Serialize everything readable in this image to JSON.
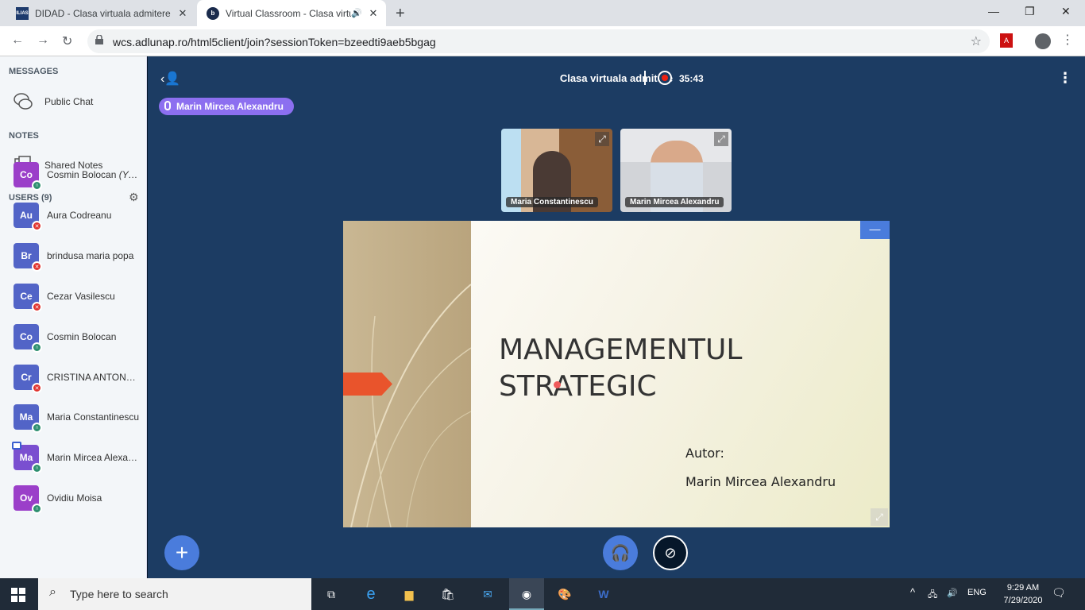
{
  "browser": {
    "tabs": [
      {
        "favicon": "ILIAS",
        "title": "DIDAD - Clasa virtuala admitere"
      },
      {
        "favicon": "b",
        "title": "Virtual Classroom - Clasa virtu"
      }
    ],
    "url": "wcs.adlunap.ro/html5client/join?sessionToken=bzeedti9aeb5bgag"
  },
  "sidebar": {
    "messages_header": "MESSAGES",
    "public_chat": "Public Chat",
    "notes_header": "NOTES",
    "shared_notes": "Shared Notes",
    "users_header": "USERS (9)",
    "users": [
      {
        "initials": "Co",
        "name": "Cosmin Bolocan",
        "suffix": "(You)",
        "color": "#9b3fc9",
        "status": "listen"
      },
      {
        "initials": "Au",
        "name": "Aura Codreanu",
        "color": "#5264c7",
        "status": "muted"
      },
      {
        "initials": "Br",
        "name": "brindusa maria popa",
        "color": "#5264c7",
        "status": "muted"
      },
      {
        "initials": "Ce",
        "name": "Cezar Vasilescu",
        "color": "#5264c7",
        "status": "muted"
      },
      {
        "initials": "Co",
        "name": "Cosmin Bolocan",
        "color": "#5264c7",
        "status": "listen"
      },
      {
        "initials": "Cr",
        "name": "CRISTINA ANTONOAIE",
        "color": "#5264c7",
        "status": "muted"
      },
      {
        "initials": "Ma",
        "name": "Maria Constantinescu",
        "color": "#5264c7",
        "status": "listen"
      },
      {
        "initials": "Ma",
        "name": "Marin Mircea Alexan…",
        "color": "#7a4fd0",
        "status": "listen",
        "presenter": true
      },
      {
        "initials": "Ov",
        "name": "Ovidiu Moisa",
        "color": "#9b3fc9",
        "status": "listen"
      }
    ]
  },
  "main": {
    "title": "Clasa virtuala admitere",
    "recording_time": "35:43",
    "talking": "Marin Mircea Alexandru",
    "videos": [
      {
        "name": "Maria Constantinescu"
      },
      {
        "name": "Marin Mircea Alexandru"
      }
    ],
    "slide": {
      "title": "MANAGEMENTUL\nSTRATEGIC",
      "author_label": "Autor:",
      "author_name": "Marin Mircea Alexandru"
    }
  },
  "taskbar": {
    "search_placeholder": "Type here to search",
    "language": "ENG",
    "time": "9:29 AM",
    "date": "7/29/2020"
  }
}
